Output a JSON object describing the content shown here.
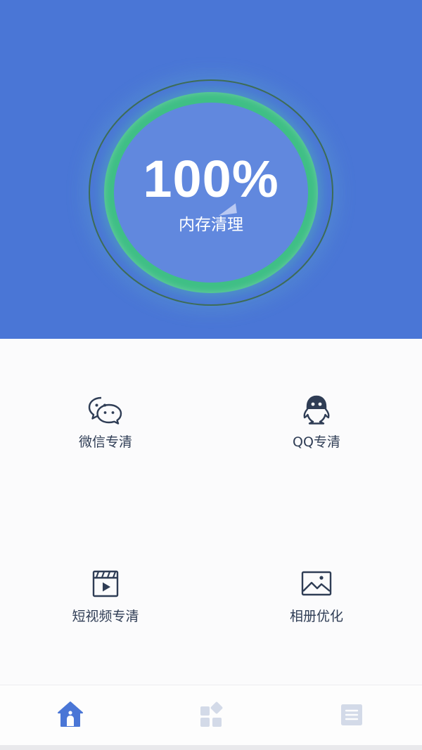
{
  "colors": {
    "hero_background": "#4a76d6",
    "ring_green": "#3fbf86",
    "inner_circle": "#6188de",
    "icon_color": "#2f3d55",
    "tab_active": "#4a76d6",
    "tab_inactive": "#d3dae8"
  },
  "gauge": {
    "percent_text": "100%",
    "progress": 1.0,
    "label": "内存清理"
  },
  "tiles": [
    {
      "label": "微信专清",
      "icon": "wechat-icon"
    },
    {
      "label": "QQ专清",
      "icon": "qq-penguin-icon"
    },
    {
      "label": "短视频专清",
      "icon": "video-clapper-icon"
    },
    {
      "label": "相册优化",
      "icon": "photo-album-icon"
    }
  ],
  "tabbar": {
    "items": [
      {
        "icon": "home-icon",
        "active": true
      },
      {
        "icon": "apps-grid-icon",
        "active": false
      },
      {
        "icon": "list-icon",
        "active": false
      }
    ]
  }
}
